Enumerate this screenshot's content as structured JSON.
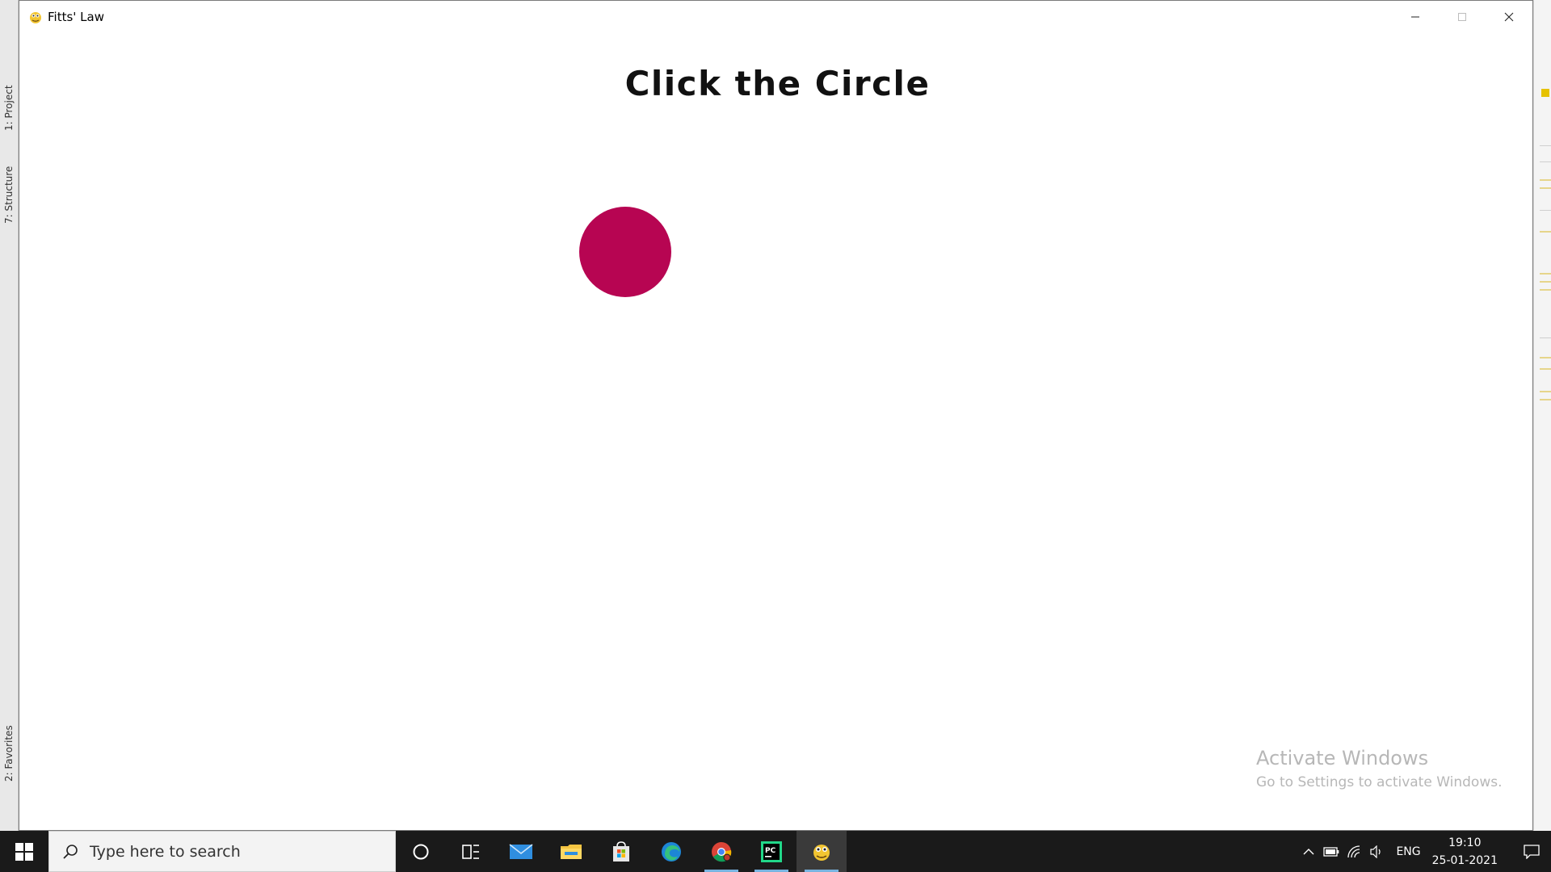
{
  "window": {
    "title": "Fitts' Law",
    "controls": {
      "minimize": "minimize",
      "maximize": "maximize",
      "close": "close"
    }
  },
  "content": {
    "heading": "Click the Circle",
    "target_color": "#b70552"
  },
  "watermark": {
    "line1": "Activate Windows",
    "line2": "Go to Settings to activate Windows."
  },
  "ide_sidebar": {
    "tabs": [
      "1: Project",
      "7: Structure",
      "2: Favorites"
    ]
  },
  "taskbar": {
    "search_placeholder": "Type here to search",
    "apps": [
      "cortana-icon",
      "task-view-icon",
      "mail-icon",
      "file-explorer-icon",
      "store-icon",
      "edge-icon",
      "chrome-icon",
      "pycharm-icon",
      "pygame-icon"
    ],
    "tray": {
      "language": "ENG",
      "time": "19:10",
      "date": "25-01-2021"
    }
  }
}
